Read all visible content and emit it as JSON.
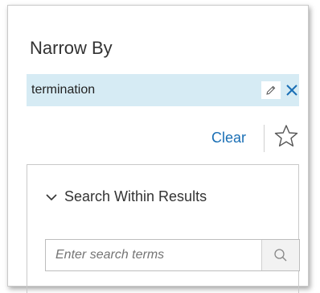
{
  "panel": {
    "title": "Narrow By"
  },
  "active_filter": {
    "term": "termination",
    "edit_icon": "pencil-icon",
    "remove_icon": "close-icon"
  },
  "actions": {
    "clear_label": "Clear",
    "favorite_icon": "star-icon"
  },
  "search_within": {
    "header_label": "Search Within Results",
    "expand_icon": "chevron-down-icon",
    "input_placeholder": "Enter search terms",
    "input_value": "",
    "search_icon": "magnifier-icon"
  },
  "colors": {
    "filter_bar_bg": "#d6ebf4",
    "link_blue": "#1a6fb5",
    "close_blue": "#1a6fb5"
  }
}
